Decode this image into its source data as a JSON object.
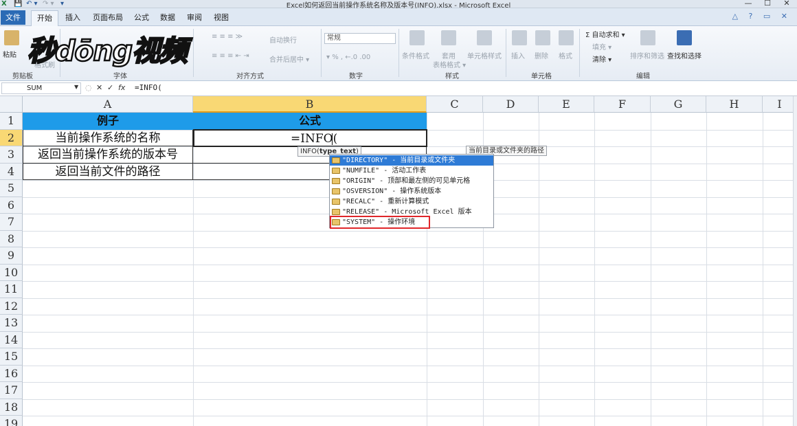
{
  "window": {
    "title": "Excel如何返回当前操作系统名称及版本号(INFO).xlsx - Microsoft Excel",
    "min_glyph": "—",
    "max_glyph": "☐",
    "close_glyph": "✕"
  },
  "quick_access": {
    "excel_glyph": "X",
    "save_glyph": "💾",
    "undo_glyph": "↶ ▾",
    "redo_glyph": "↷ ▾",
    "more_glyph": "▾"
  },
  "tabs": {
    "file": "文件",
    "items": [
      "开始",
      "插入",
      "页面布局",
      "公式",
      "数据",
      "审阅",
      "视图"
    ],
    "right_icons": "△ ? ▭ ✕"
  },
  "ribbon": {
    "clipboard": {
      "label": "剪贴板",
      "paste": "粘贴",
      "format_painter": "格式刷"
    },
    "font": {
      "label": "字体"
    },
    "alignment": {
      "label": "对齐方式",
      "wrap_text": "自动换行",
      "merge_center": "合并后居中 ▾"
    },
    "number": {
      "label": "数字",
      "format_value": "常规",
      "symbols": "▾ % , ←.0 .00"
    },
    "styles": {
      "label": "样式",
      "conditional": "条件格式",
      "table_format": "套用\n表格格式",
      "table_format_1": "套用",
      "table_format_2": "表格格式 ▾",
      "cell_styles": "单元格样式"
    },
    "cells": {
      "label": "单元格",
      "insert": "插入",
      "delete": "删除",
      "format": "格式"
    },
    "editing": {
      "label": "编辑",
      "autosum": "Σ 自动求和 ▾",
      "fill": "填充 ▾",
      "clear": "清除 ▾",
      "sort_filter": "排序和筛选",
      "find_select": "查找和选择"
    }
  },
  "logo": {
    "text": "秒dōng视频"
  },
  "formula_bar": {
    "name_box": "SUM",
    "cancel": "✕",
    "enter": "✓",
    "fx": "fx",
    "formula": "=INFO("
  },
  "columns": [
    "A",
    "B",
    "C",
    "D",
    "E",
    "F",
    "G",
    "H",
    "I"
  ],
  "rows": [
    "1",
    "2",
    "3",
    "4",
    "5",
    "6",
    "7",
    "8",
    "9",
    "10",
    "11",
    "12",
    "13",
    "14",
    "15",
    "16",
    "17",
    "18",
    "19"
  ],
  "cells": {
    "A1": "例子",
    "B1": "公式",
    "A2": "当前操作系统的名称",
    "A3": "返回当前操作系统的版本号",
    "A4": "返回当前文件的路径",
    "B2": "=INFO("
  },
  "tooltips": {
    "syntax_prefix": "INFO(",
    "syntax_arg": "type_text",
    "syntax_suffix": ")",
    "description": "当前目录或文件夹的路径"
  },
  "autocomplete": [
    "\"DIRECTORY\" - 当前目录或文件夹",
    "\"NUMFILE\" - 活动工作表",
    "\"ORIGIN\" - 顶部和最左侧的可见单元格",
    "\"OSVERSION\" - 操作系统版本",
    "\"RECALC\" - 重新计算模式",
    "\"RELEASE\" - Microsoft Excel 版本",
    "\"SYSTEM\" - 操作环境"
  ],
  "colors": {
    "header_fill": "#1e9be9",
    "selection_header": "#f9d874",
    "dropdown_selected": "#2e7bd6",
    "highlight": "#e0262a"
  }
}
